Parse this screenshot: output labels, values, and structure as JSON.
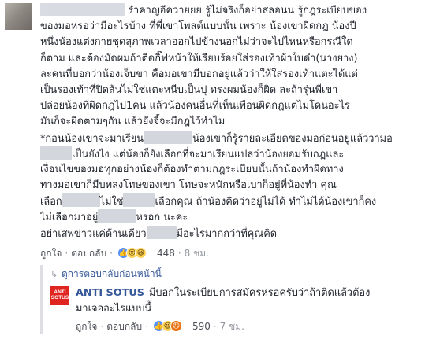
{
  "comment": {
    "lines": [
      [
        "",
        " รำคาญอีควายยย รู้ไม่จริงก็อย่าสลอนน รู้กฎระเบียบของ"
      ],
      [
        "ของมอหรอว่ามีอะไรบ้าง ที่พี่เขาโพสต์แบบนั้น เพราะ น้องเขาผิดกฎ น้องปี"
      ],
      [
        "หนึ่งน้องแต่งกายชุดสุภาพเวลาออกไปข้างนอกไม่ว่าจะไปไหนหรือกรณีใด"
      ],
      [
        "ก็ตาม และต้องมัดผมถ้าติดกิ๊ฟหน้าให้เรียบร้อยใส่รองเท้าผ้าใบดำ(นางยาง)"
      ],
      [
        "ละคนที่บอกว่าน้องเจ็บขา คือมอเขามีบอกอยู่แล้วว่าให้ใส่รองเท้าแตะได้แต่"
      ],
      [
        "เป็นรองเท้าที่ปิดส้นไม่ใช่แตะหนีบเป็นปุ ทรงผมน้องก็ผิด ละถ้ารุ่นพี่เขา"
      ],
      [
        "ปล่อยน้องที่ผิดกฎไป1คน แล้วน้องคนอื่นที่เห็นเพื่อนผิดกฎแต่ไม่โดนอะไร"
      ],
      [
        "มันก็จะผิดตามๆกัน แล้วยังจี้จะมีกฎไว้ทำไม"
      ],
      [
        "*ก่อนน้องเขาจะมาเรียน",
        "น้องเขาก็รู้รายละเอียดของมอก่อนอยู่แล้ววามอ"
      ],
      [
        "",
        "เป็นยังไง แต่น้องก็ยังเลือกที่จะมาเรียนแปลว่าน้องยอมรับกฎและ"
      ],
      [
        "เงื่อนไขของมอทุกอย่างน้องก็ต้องทำตามกฎระเบียบนั้นถ้าน้องทำผิดทาง"
      ],
      [
        "ทางมอเขาก็มีบทลงโทษของเขา โทษจะหนักหรือเบาก็อยู่ที่น้องทำ คุณ"
      ],
      [
        "เลือก",
        "ไม่ใช่",
        "เลือกคุณ ถ้าน้องคิดว่าอยู่ไม่ได้ ทำไม่ได้น้องเขาก็คง"
      ],
      [
        "ไม่เลือกมาอยู่",
        "หรอก นะคะ"
      ],
      [
        "อย่าเสพข่าวแค่ด้านเดียว",
        "มีอะไรมากกว่าที่คุณคิด"
      ]
    ],
    "like": "ถูกใจ",
    "reply": "ตอบกลับ",
    "reaction_count": "448",
    "time": "8 ชม."
  },
  "view_previous": "ดูการตอบกลับก่อนหน้านี้",
  "reply": {
    "avatar_text": "ANTI SOTUS",
    "author": "ANTI SOTUS",
    "text_line1": "มีบอกในระเบียบการสมัครหรอครับว่าถ้าติดแล้วต้อง",
    "text_line2": "มาเจออะไรแบบนี้",
    "like": "ถูกใจ",
    "reply": "ตอบกลับ",
    "reaction_count": "590",
    "time": "7 ชม."
  },
  "colors": {
    "link": "#365899",
    "meta": "#90949c",
    "redaction": "#d3d6dc",
    "brand_red": "#e02420"
  },
  "icons": [
    "like-reaction-icon",
    "wow-reaction-icon",
    "haha-reaction-icon",
    "angry-reaction-icon",
    "reply-arrow-icon"
  ]
}
